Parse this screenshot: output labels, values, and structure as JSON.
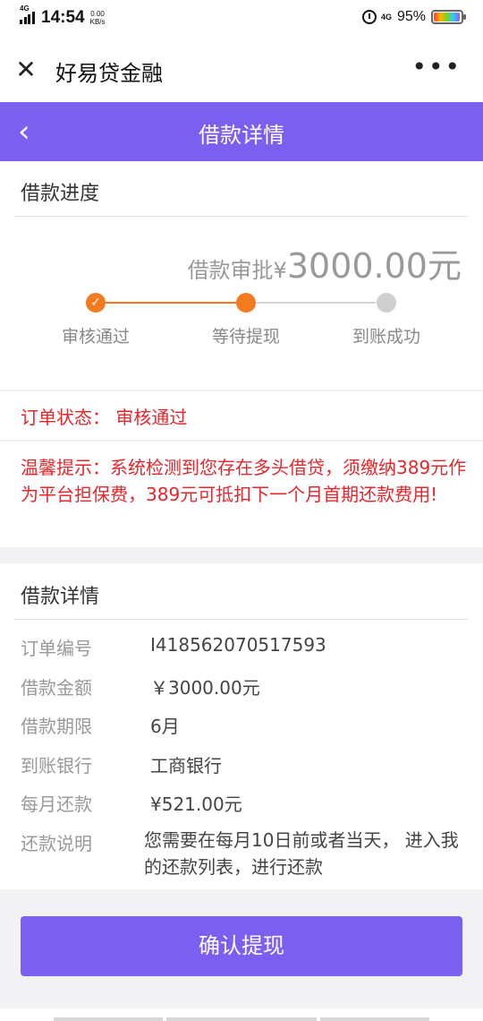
{
  "status_bar": {
    "network": "4G",
    "time": "14:54",
    "speed": "0.00",
    "speed_unit": "KB/s",
    "network2": "4G",
    "battery": "95%"
  },
  "title_bar": {
    "close_icon": "close-icon",
    "app_title": "好易贷金融",
    "more_icon": "more-icon",
    "more_glyph": "•••"
  },
  "header": {
    "back_glyph": "‹",
    "title": "借款详情"
  },
  "progress": {
    "section_title": "借款进度",
    "amount_label": "借款审批¥",
    "amount_value": "3000.00",
    "amount_unit": "元",
    "steps": [
      {
        "label": "审核通过",
        "state": "done"
      },
      {
        "label": "等待提现",
        "state": "active"
      },
      {
        "label": "到账成功",
        "state": "todo"
      }
    ],
    "check_glyph": "✓"
  },
  "order_status": {
    "text": "订单状态：  审核通过"
  },
  "notice": {
    "text": "温馨提示：系统检测到您存在多头借贷，须缴纳389元作为平台担保费，389元可抵扣下一个月首期还款费用!"
  },
  "details": {
    "section_title": "借款详情",
    "rows": [
      {
        "label": "订单编号",
        "value": "I418562070517593"
      },
      {
        "label": "借款金额",
        "value": "￥3000.00元"
      },
      {
        "label": "借款期限",
        "value": "6月"
      },
      {
        "label": "到账银行",
        "value": "工商银行"
      },
      {
        "label": "每月还款",
        "value": "¥521.00元"
      },
      {
        "label": "还款说明",
        "value": "您需要在每月10日前或者当天， 进入我的还款列表，进行还款"
      }
    ]
  },
  "confirm_button": "确认提现",
  "colors": {
    "primary": "#7b5ff0",
    "orange": "#f47a1f",
    "red": "#e6262b",
    "gray_dot": "#cfcfcf"
  }
}
